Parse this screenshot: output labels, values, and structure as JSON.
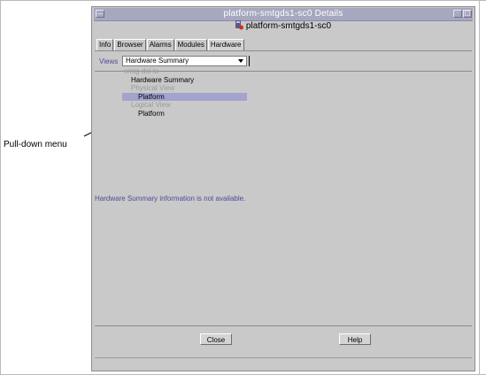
{
  "callout": {
    "label": "Pull-down menu"
  },
  "window": {
    "title": "platform-smtgds1-sc0 Details",
    "subtitle": "platform-smtgds1-sc0",
    "icons": {
      "menu": "window-menu-icon",
      "minimize": "minimize-icon",
      "maximize": "maximize-icon",
      "host": "host-status-icon"
    }
  },
  "tabs": [
    {
      "label": "Info"
    },
    {
      "label": "Browser"
    },
    {
      "label": "Alarms"
    },
    {
      "label": "Modules"
    },
    {
      "label": "Hardware"
    }
  ],
  "views": {
    "label": "Views",
    "selected": "Hardware Summary",
    "options": [
      {
        "label": "smtg-dsl-la"
      },
      {
        "label": "Hardware Summary"
      },
      {
        "label": "Physical View"
      },
      {
        "label": "Platform"
      },
      {
        "label": "Logical View"
      },
      {
        "label": "Platform"
      }
    ]
  },
  "message": "Hardware Summary information is not available.",
  "buttons": {
    "close": "Close",
    "help": "Help"
  },
  "colors": {
    "title_bar": "#a7a7c0",
    "window_bg": "#c9c9c9",
    "highlight": "#a3a3cf",
    "info_text": "#4b4b9a"
  }
}
